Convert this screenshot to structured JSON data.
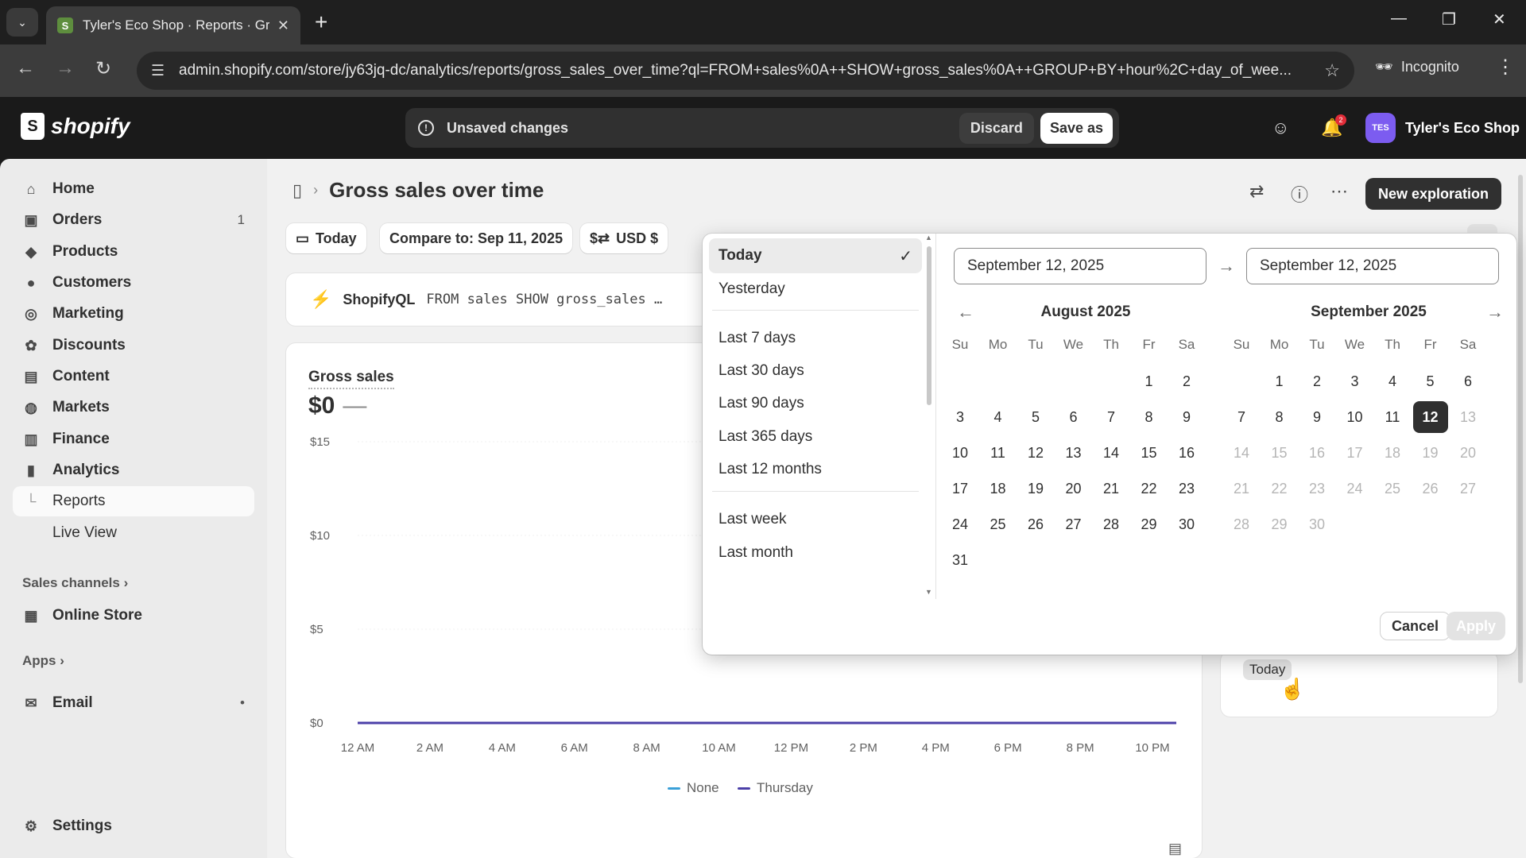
{
  "browser": {
    "tab_title": "Tyler's Eco Shop · Reports · Gro",
    "url": "admin.shopify.com/store/jy63jq-dc/analytics/reports/gross_sales_over_time?ql=FROM+sales%0A++SHOW+gross_sales%0A++GROUP+BY+hour%2C+day_of_wee...",
    "incognito_label": "Incognito"
  },
  "topbar": {
    "logo_text": "shopify",
    "unsaved_label": "Unsaved changes",
    "discard_label": "Discard",
    "save_as_label": "Save as",
    "notification_count": "2",
    "store_initials": "TES",
    "store_name": "Tyler's Eco Shop"
  },
  "sidebar": {
    "items": [
      {
        "label": "Home",
        "icon": "home-icon"
      },
      {
        "label": "Orders",
        "icon": "orders-icon",
        "count": "1"
      },
      {
        "label": "Products",
        "icon": "tag-icon"
      },
      {
        "label": "Customers",
        "icon": "person-icon"
      },
      {
        "label": "Marketing",
        "icon": "target-icon"
      },
      {
        "label": "Discounts",
        "icon": "discount-icon"
      },
      {
        "label": "Content",
        "icon": "content-icon"
      },
      {
        "label": "Markets",
        "icon": "globe-icon"
      },
      {
        "label": "Finance",
        "icon": "bank-icon"
      },
      {
        "label": "Analytics",
        "icon": "chart-icon"
      },
      {
        "label": "Reports"
      },
      {
        "label": "Live View"
      }
    ],
    "sales_channels_label": "Sales channels",
    "online_store_label": "Online Store",
    "apps_label": "Apps",
    "email_label": "Email",
    "settings_label": "Settings"
  },
  "page": {
    "title": "Gross sales over time",
    "new_exploration_label": "New exploration",
    "filter_today": "Today",
    "compare_label": "Compare to: Sep 11, 2025",
    "currency_label": "USD $",
    "shopifyql_label": "ShopifyQL",
    "shopifyql_code": "FROM sales SHOW gross_sales …"
  },
  "card": {
    "title": "Gross sales",
    "value": "$0",
    "value_dash": "—"
  },
  "chart_data": {
    "type": "line",
    "yticks": [
      "$15",
      "$10",
      "$5",
      "$0"
    ],
    "ylim": [
      0,
      15
    ],
    "categories": [
      "12 AM",
      "2 AM",
      "4 AM",
      "6 AM",
      "8 AM",
      "10 AM",
      "12 PM",
      "2 PM",
      "4 PM",
      "6 PM",
      "8 PM",
      "10 PM"
    ],
    "series": [
      {
        "name": "None",
        "color": "#3aa0d8",
        "values": [
          0,
          0,
          0,
          0,
          0,
          0,
          0,
          0,
          0,
          0,
          0,
          0
        ]
      },
      {
        "name": "Thursday",
        "color": "#4b3fa8",
        "values": [
          0,
          0,
          0,
          0,
          0,
          0,
          0,
          0,
          0,
          0,
          0,
          0
        ]
      }
    ]
  },
  "datepicker": {
    "presets": [
      "Today",
      "Yesterday",
      "Last 7 days",
      "Last 30 days",
      "Last 90 days",
      "Last 365 days",
      "Last 12 months",
      "Last week",
      "Last month"
    ],
    "selected_preset": "Today",
    "start_date": "September 12, 2025",
    "end_date": "September 12, 2025",
    "weekdays": [
      "Su",
      "Mo",
      "Tu",
      "We",
      "Th",
      "Fr",
      "Sa"
    ],
    "left_month": {
      "title": "August 2025",
      "first_weekday": 5,
      "days": 31
    },
    "right_month": {
      "title": "September 2025",
      "first_weekday": 1,
      "days": 30,
      "selected_day": 12,
      "last_enabled_day": 12
    },
    "cancel_label": "Cancel",
    "apply_label": "Apply"
  },
  "right_panel": {
    "today_chip": "Today"
  }
}
